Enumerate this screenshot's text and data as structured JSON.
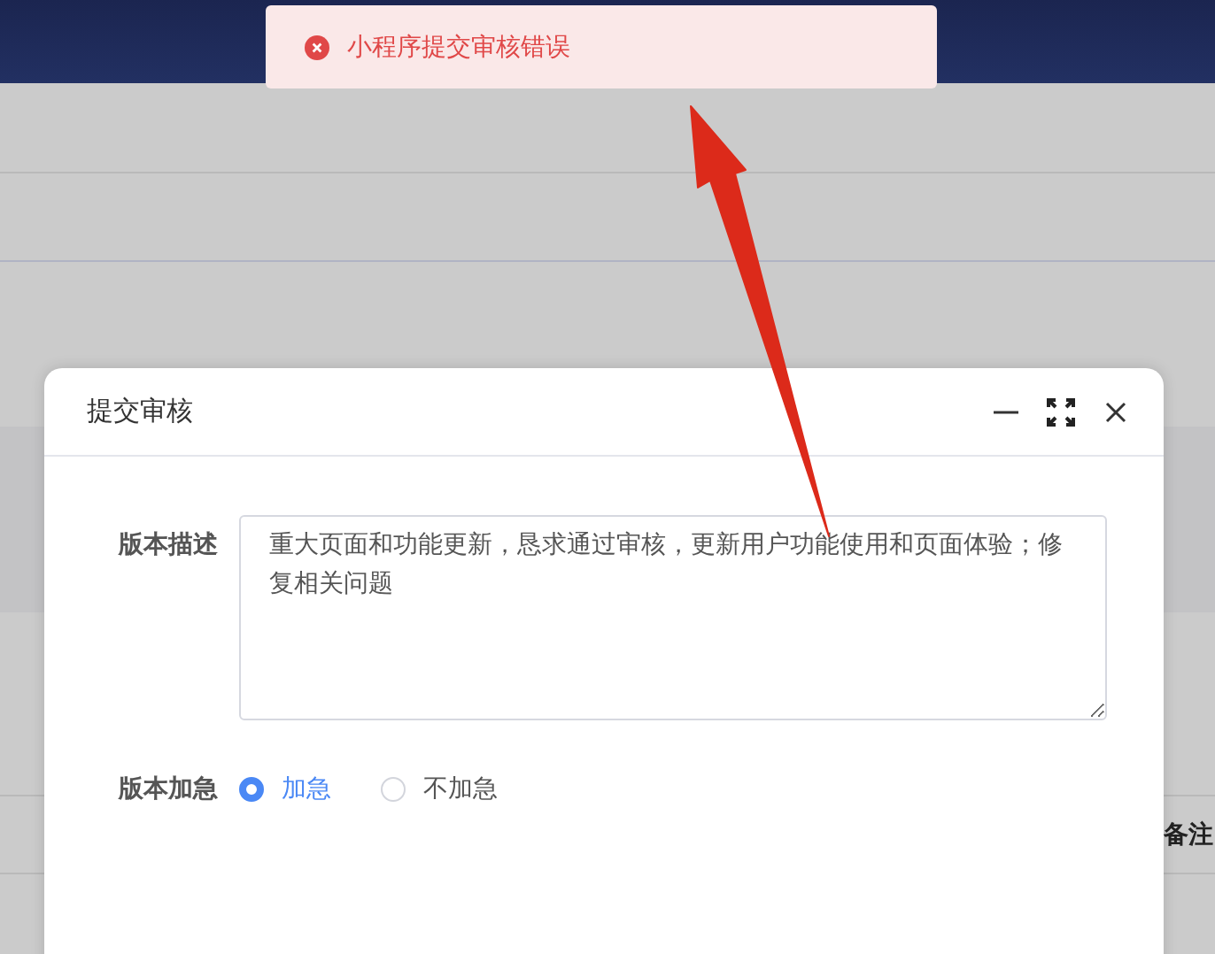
{
  "table": {
    "row_fragment": "备注"
  },
  "toast": {
    "kind": "error",
    "message": "小程序提交审核错误"
  },
  "dialog": {
    "title": "提交审核",
    "fields": [
      {
        "kind": "textarea",
        "label": "版本描述",
        "value": "重大页面和功能更新，恳求通过审核，更新用户功能使用和页面体验；修复相关问题"
      },
      {
        "kind": "radio",
        "label": "版本加急",
        "options": [
          {
            "label": "加急",
            "selected": true
          },
          {
            "label": "不加急",
            "selected": false
          }
        ]
      }
    ]
  }
}
